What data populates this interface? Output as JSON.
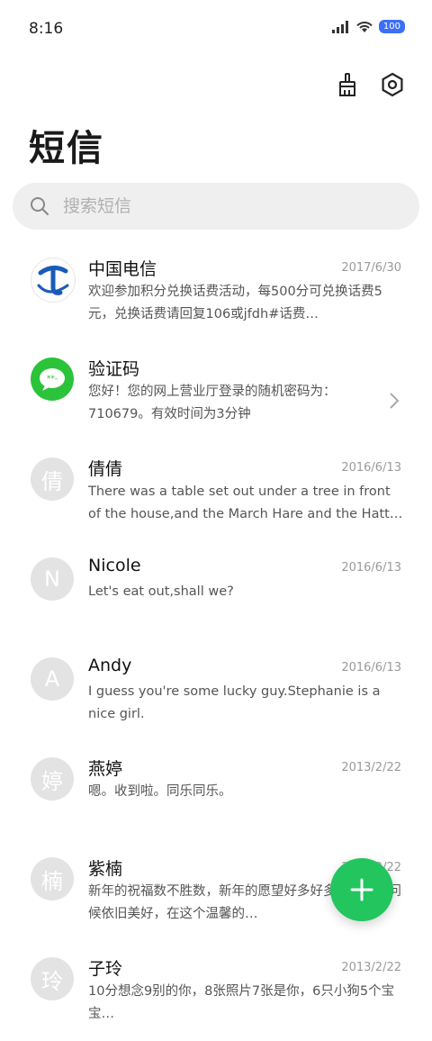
{
  "status_bar": {
    "time": "8:16",
    "battery": "100"
  },
  "header": {
    "title": "短信"
  },
  "search": {
    "placeholder": "搜索短信"
  },
  "messages": [
    {
      "name": "中国电信",
      "date": "2017/6/30",
      "preview": "欢迎参加积分兑换话费活动，每500分可兑换话费5元，兑换话费请回复106或jfdh#话费…",
      "avatar": "telecom-logo"
    },
    {
      "name": "验证码",
      "date": "",
      "preview": "您好！您的网上营业厅登录的随机密码为：710679。有效时间为3分钟",
      "avatar": "message-bubble"
    },
    {
      "name": "倩倩",
      "date": "2016/6/13",
      "preview": "There was a table set out under a tree in front of the house,and the March Hare and the Hatter we…",
      "avatar_letter": "倩"
    },
    {
      "name": "Nicole",
      "date": "2016/6/13",
      "preview": "Let's eat out,shall we?",
      "avatar_letter": "N"
    },
    {
      "name": "Andy",
      "date": "2016/6/13",
      "preview": "I guess you're some lucky guy.Stephanie is a nice girl.",
      "avatar_letter": "A"
    },
    {
      "name": "燕婷",
      "date": "2013/2/22",
      "preview": "嗯。收到啦。同乐同乐。",
      "avatar_letter": "婷"
    },
    {
      "name": "紫楠",
      "date": "2013/2/22",
      "preview": "新年的祝福数不胜数，新年的愿望好多好多，新年的问候依旧美好，在这个温馨的…",
      "avatar_letter": "楠"
    },
    {
      "name": "子玲",
      "date": "2013/2/22",
      "preview": "10分想念9别的你，8张照片7张是你，6只小狗5个宝宝…",
      "avatar_letter": "玲"
    }
  ],
  "colors": {
    "accent": "#22c55e",
    "battery": "#3b6ff5",
    "telecom": "#1a5bb8"
  }
}
